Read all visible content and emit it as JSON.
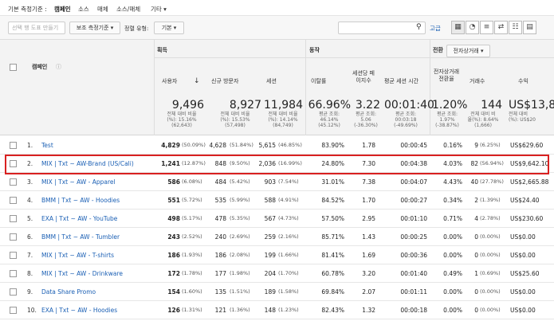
{
  "topbar": {
    "label": "기본 측정기준 :",
    "tabs": [
      "캠페인",
      "소스",
      "매체",
      "소스/매체",
      "기타 ▾"
    ]
  },
  "toolbar": {
    "secondary_dim_placeholder": "선택 행 도표 만들기",
    "secondary_dim_label": "보조 측정기준 ▾",
    "sort_type_label": "정렬 유형:",
    "sort_type_value": "기본 ▾",
    "search_icon": "search-icon",
    "advanced_label": "고급",
    "view_icons": [
      "table-view-icon",
      "pie-view-icon",
      "performance-view-icon",
      "comparison-view-icon",
      "term-cloud-icon",
      "pivot-view-icon"
    ]
  },
  "header": {
    "campaign_col": "캠페인",
    "groups": {
      "acquisition": "획득",
      "behavior": "동작",
      "conversion": "전환",
      "conversion_select": "전자상거래 ▾"
    },
    "columns": [
      "사용자",
      "신규 방문자",
      "세션",
      "이탈률",
      "세션당 페이지수",
      "평균 세션 시간",
      "전자상거래 전환율",
      "거래수",
      "수익"
    ],
    "sort_arrow": "↓"
  },
  "totals": [
    {
      "big": "9,496",
      "l1": "전체 대비 비율",
      "l2": "(%): 15.16%",
      "l3": "(62,643)"
    },
    {
      "big": "8,927",
      "l1": "전체 대비 비율",
      "l2": "(%): 15.53%",
      "l3": "(57,498)"
    },
    {
      "big": "11,984",
      "l1": "전체 대비 비율",
      "l2": "(%): 14.14%",
      "l3": "(84,749)"
    },
    {
      "big": "66.96%",
      "l1": "평균 조회:",
      "l2": "46.14%",
      "l3": "(45.12%)"
    },
    {
      "big": "3.22",
      "l1": "평균 조회:",
      "l2": "5.06",
      "l3": "(-36.30%)"
    },
    {
      "big": "00:01:40",
      "l1": "평균 조회:",
      "l2": "00:03:18",
      "l3": "(-49.69%)"
    },
    {
      "big": "1.20%",
      "l1": "평균 조회:",
      "l2": "1.97%",
      "l3": "(-38.87%)"
    },
    {
      "big": "144",
      "l1": "전체 대비 비",
      "l2": "율(%): 8.64%",
      "l3": "(1,666)"
    },
    {
      "big": "US$13,8",
      "l1": "전체 대비",
      "l2": "(%): US$20",
      "l3": ""
    }
  ],
  "rows": [
    {
      "n": "1.",
      "camp": "Test",
      "u": "4,829",
      "up": "(50.09%)",
      "nv": "4,628",
      "nvp": "(51.84%)",
      "s": "5,615",
      "sp": "(46.85%)",
      "br": "83.90%",
      "pps": "1.78",
      "dur": "00:00:45",
      "cr": "0.16%",
      "tx": "9",
      "txp": "(6.25%)",
      "rev": "US$629.60"
    },
    {
      "n": "2.",
      "camp": "MIX | Txt ~ AW-Brand (US/Cali)",
      "u": "1,241",
      "up": "(12.87%)",
      "nv": "848",
      "nvp": "(9.50%)",
      "s": "2,036",
      "sp": "(16.99%)",
      "br": "24.80%",
      "pps": "7.30",
      "dur": "00:04:38",
      "cr": "4.03%",
      "tx": "82",
      "txp": "(56.94%)",
      "rev": "US$9,642.10"
    },
    {
      "n": "3.",
      "camp": "MIX | Txt ~ AW - Apparel",
      "u": "586",
      "up": "(6.08%)",
      "nv": "484",
      "nvp": "(5.42%)",
      "s": "903",
      "sp": "(7.54%)",
      "br": "31.01%",
      "pps": "7.38",
      "dur": "00:04:07",
      "cr": "4.43%",
      "tx": "40",
      "txp": "(27.78%)",
      "rev": "US$2,665.88"
    },
    {
      "n": "4.",
      "camp": "BMM | Txt ~ AW - Hoodies",
      "u": "551",
      "up": "(5.72%)",
      "nv": "535",
      "nvp": "(5.99%)",
      "s": "588",
      "sp": "(4.91%)",
      "br": "84.52%",
      "pps": "1.70",
      "dur": "00:00:27",
      "cr": "0.34%",
      "tx": "2",
      "txp": "(1.39%)",
      "rev": "US$24.40"
    },
    {
      "n": "5.",
      "camp": "EXA | Txt ~ AW - YouTube",
      "u": "498",
      "up": "(5.17%)",
      "nv": "478",
      "nvp": "(5.35%)",
      "s": "567",
      "sp": "(4.73%)",
      "br": "57.50%",
      "pps": "2.95",
      "dur": "00:01:10",
      "cr": "0.71%",
      "tx": "4",
      "txp": "(2.78%)",
      "rev": "US$230.60"
    },
    {
      "n": "6.",
      "camp": "BMM | Txt ~ AW - Tumbler",
      "u": "243",
      "up": "(2.52%)",
      "nv": "240",
      "nvp": "(2.69%)",
      "s": "259",
      "sp": "(2.16%)",
      "br": "85.71%",
      "pps": "1.43",
      "dur": "00:00:25",
      "cr": "0.00%",
      "tx": "0",
      "txp": "(0.00%)",
      "rev": "US$0.00"
    },
    {
      "n": "7.",
      "camp": "MIX | Txt ~ AW - T-shirts",
      "u": "186",
      "up": "(1.93%)",
      "nv": "186",
      "nvp": "(2.08%)",
      "s": "199",
      "sp": "(1.66%)",
      "br": "81.41%",
      "pps": "1.69",
      "dur": "00:00:36",
      "cr": "0.00%",
      "tx": "0",
      "txp": "(0.00%)",
      "rev": "US$0.00"
    },
    {
      "n": "8.",
      "camp": "MIX | Txt ~ AW - Drinkware",
      "u": "172",
      "up": "(1.78%)",
      "nv": "177",
      "nvp": "(1.98%)",
      "s": "204",
      "sp": "(1.70%)",
      "br": "60.78%",
      "pps": "3.20",
      "dur": "00:01:40",
      "cr": "0.49%",
      "tx": "1",
      "txp": "(0.69%)",
      "rev": "US$25.60"
    },
    {
      "n": "9.",
      "camp": "Data Share Promo",
      "u": "154",
      "up": "(1.60%)",
      "nv": "135",
      "nvp": "(1.51%)",
      "s": "189",
      "sp": "(1.58%)",
      "br": "69.84%",
      "pps": "2.07",
      "dur": "00:01:11",
      "cr": "0.00%",
      "tx": "0",
      "txp": "(0.00%)",
      "rev": "US$0.00"
    },
    {
      "n": "10.",
      "camp": "EXA | Txt ~ AW - Hoodies",
      "u": "126",
      "up": "(1.31%)",
      "nv": "121",
      "nvp": "(1.36%)",
      "s": "148",
      "sp": "(1.23%)",
      "br": "82.43%",
      "pps": "1.32",
      "dur": "00:00:18",
      "cr": "0.00%",
      "tx": "0",
      "txp": "(0.00%)",
      "rev": "US$0.00"
    }
  ]
}
